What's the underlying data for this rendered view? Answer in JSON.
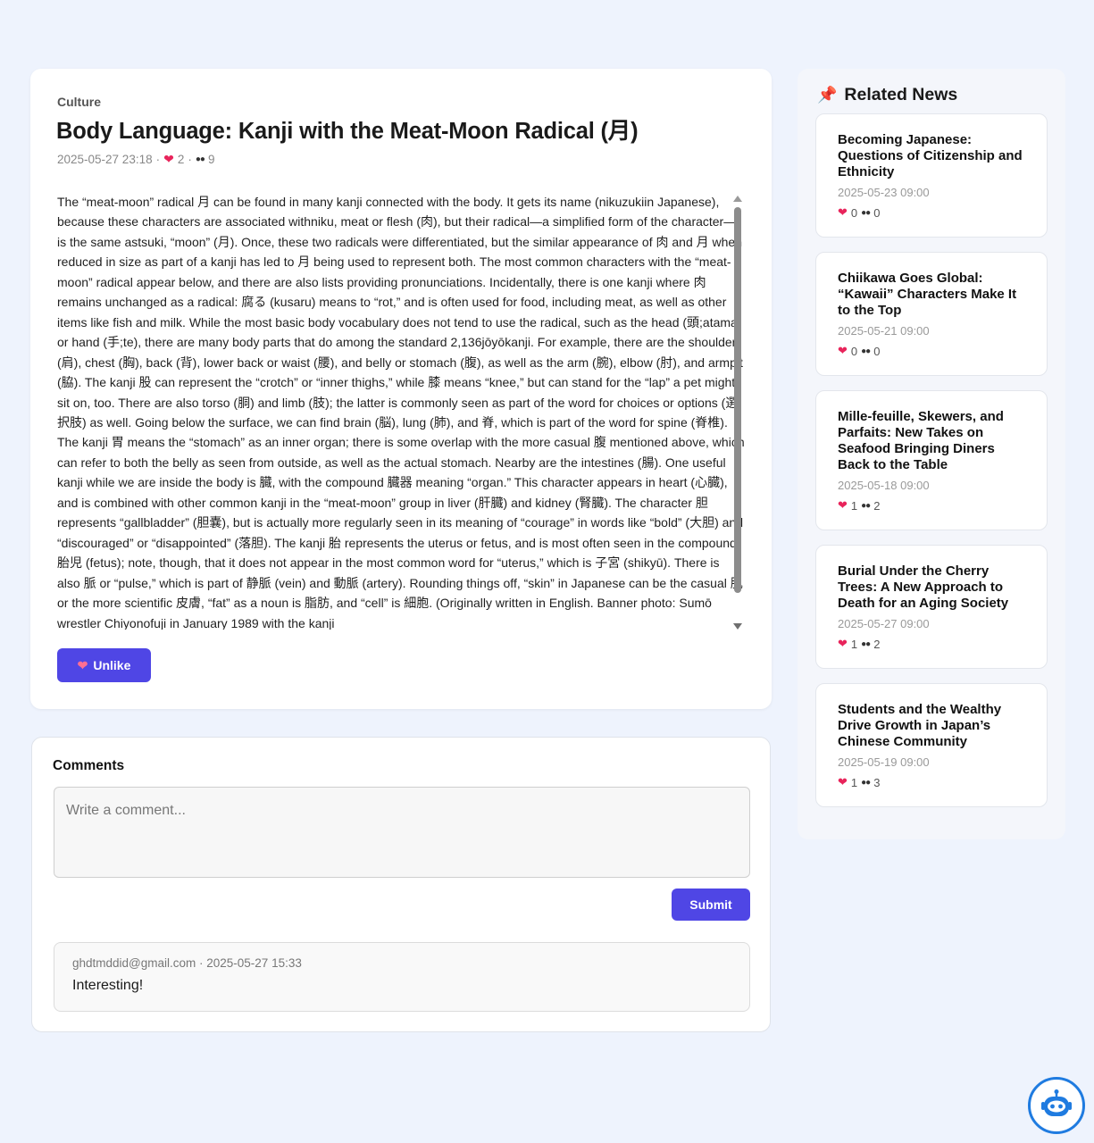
{
  "article": {
    "category": "Culture",
    "title": "Body Language: Kanji with the Meat-Moon Radical (月)",
    "date": "2025-05-27 23:18",
    "likes": "2",
    "views": "9",
    "body": "The “meat-moon” radical 月 can be found in many kanji connected with the body. It gets its name (nikuzukiin Japanese), because these characters are associated withniku, meat or flesh (肉), but their radical—a simplified form of the character—is the same astsuki, “moon” (月). Once, these two radicals were differentiated, but the similar appearance of 肉 and 月 when reduced in size as part of a kanji has led to 月 being used to represent both. The most common characters with the “meat-moon” radical appear below, and there are also lists providing pronunciations. Incidentally, there is one kanji where 肉 remains unchanged as a radical: 腐る (kusaru) means to “rot,” and is often used for food, including meat, as well as other items like fish and milk. While the most basic body vocabulary does not tend to use the radical, such as the head (頭;atama) or hand (手;te), there are many body parts that do among the standard 2,136jōyōkanji. For example, there are the shoulder (肩), chest (胸), back (背), lower back or waist (腰), and belly or stomach (腹), as well as the arm (腕), elbow (肘), and armpit (脇). The kanji 股 can represent the “crotch” or “inner thighs,” while 膝 means “knee,” but can stand for the “lap” a pet might sit on, too. There are also torso (胴) and limb (肢); the latter is commonly seen as part of the word for choices or options (選択肢) as well. Going below the surface, we can find brain (脳), lung (肺), and 脊, which is part of the word for spine (脊椎). The kanji 胃 means the “stomach” as an inner organ; there is some overlap with the more casual 腹 mentioned above, which can refer to both the belly as seen from outside, as well as the actual stomach. Nearby are the intestines (腸). One useful kanji while we are inside the body is 臓, with the compound 臓器 meaning “organ.” This character appears in heart (心臓), and is combined with other common kanji in the “meat-moon” group in liver (肝臓) and kidney (腎臓). The character 胆 represents “gallbladder” (胆嚢), but is actually more regularly seen in its meaning of “courage” in words like “bold” (大胆) and “discouraged” or “disappointed” (落胆). The kanji 胎 represents the uterus or fetus, and is most often seen in the compound 胎児 (fetus); note, though, that it does not appear in the most common word for “uterus,” which is 子宮 (shikyū). There is also 脈 or “pulse,” which is part of 静脈 (vein) and 動脈 (artery). Rounding things off, “skin” in Japanese can be the casual 肌 or the more scientific 皮膚, “fat” as a noun is 脂肪, and “cell” is 細胞. (Originally written in English. Banner photo: Sumō wrestler Chiyonofuji in January 1989 with the kanji",
    "unlike_label": "Unlike"
  },
  "comments": {
    "title": "Comments",
    "placeholder": "Write a comment...",
    "submit_label": "Submit",
    "items": [
      {
        "meta": "ghdtmddid@gmail.com · 2025-05-27 15:33",
        "text": "Interesting!"
      }
    ]
  },
  "sidebar": {
    "title": "Related News",
    "items": [
      {
        "title": "Becoming Japanese: Questions of Citizenship and Ethnicity",
        "date": "2025-05-23 09:00",
        "likes": "0",
        "views": "0"
      },
      {
        "title": "Chiikawa Goes Global: “Kawaii” Characters Make It to the Top",
        "date": "2025-05-21 09:00",
        "likes": "0",
        "views": "0"
      },
      {
        "title": "Mille-feuille, Skewers, and Parfaits: New Takes on Seafood Bringing Diners Back to the Table",
        "date": "2025-05-18 09:00",
        "likes": "1",
        "views": "2"
      },
      {
        "title": "Burial Under the Cherry Trees: A New Approach to Death for an Aging Society",
        "date": "2025-05-27 09:00",
        "likes": "1",
        "views": "2"
      },
      {
        "title": "Students and the Wealthy Drive Growth in Japan’s Chinese Community",
        "date": "2025-05-19 09:00",
        "likes": "1",
        "views": "3"
      }
    ]
  },
  "icons": {
    "heart": "heart-icon",
    "views": "eyes-icon",
    "pin": "pushpin-icon",
    "chatbot": "robot-icon"
  },
  "colors": {
    "accent": "#4f46e5",
    "heart": "#e8245b",
    "background": "#eef3fd",
    "chatbot": "#1f7be0"
  }
}
